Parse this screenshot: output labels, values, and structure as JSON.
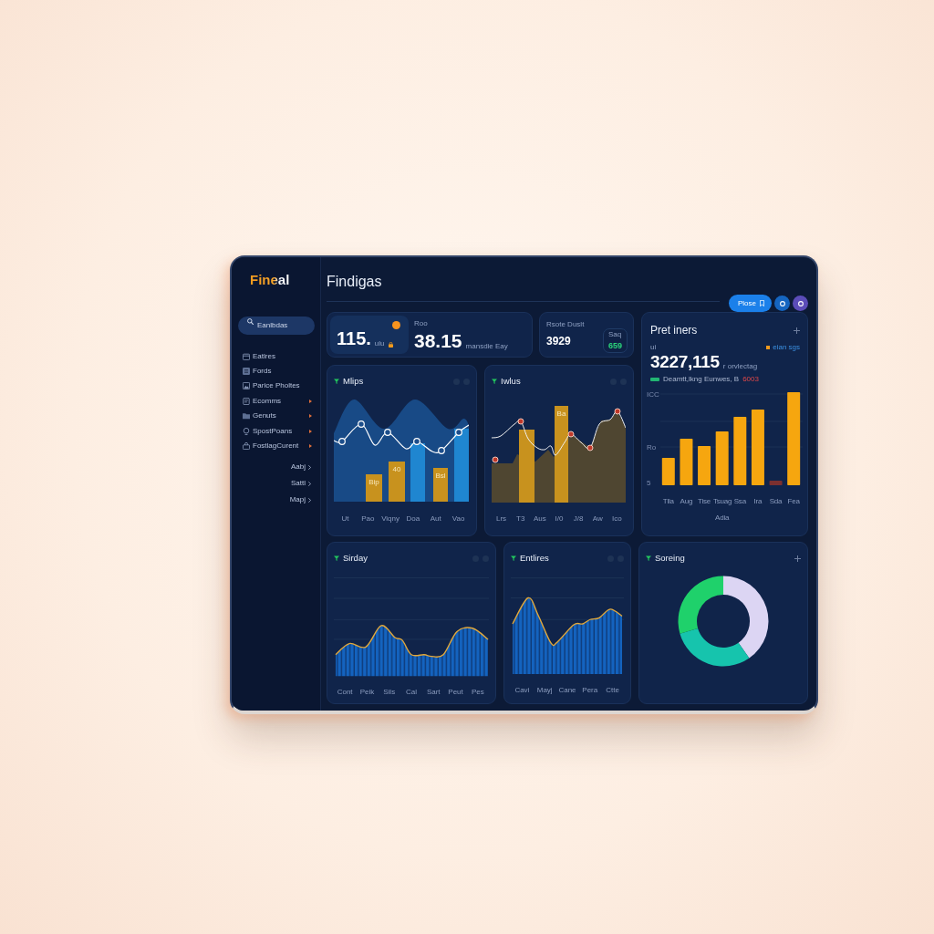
{
  "sidebar": {
    "logo": "Fineal",
    "search": {
      "placeholder": "Eanlbdas"
    },
    "items": [
      {
        "label": "Eatlres",
        "submenu": false
      },
      {
        "label": "Fords",
        "submenu": false
      },
      {
        "label": "Parice Pholtes",
        "submenu": false
      },
      {
        "label": "Ecomms",
        "submenu": true
      },
      {
        "label": "Genuts",
        "submenu": true
      },
      {
        "label": "SpostPoans",
        "submenu": true
      },
      {
        "label": "FostlagCurent",
        "submenu": true
      }
    ],
    "links": [
      "Aabj",
      "Sattl",
      "Mapj"
    ]
  },
  "header": {
    "title": "Findigas",
    "button": "Plose"
  },
  "stats": {
    "primary": {
      "value": "115.",
      "unit": "ulu"
    },
    "secondary": {
      "label": "Roo",
      "value": "38.15",
      "caption": "mansdie Eay"
    }
  },
  "balance": {
    "label": "Rsote Duslt",
    "value": "3929",
    "badge": {
      "label": "Saq",
      "value": "659"
    }
  },
  "revenue": {
    "title": "Pret iners",
    "axis_unit": "ui",
    "total": "3227,115",
    "total_caption": "r orvlectag",
    "tag": "eian sgs",
    "legend": {
      "label": "Deamtt,lkng Eunwes, B",
      "value": "6003"
    },
    "y_labels": [
      "ICC",
      "Ro",
      "5"
    ],
    "x_labels": [
      "Tlla",
      "Aug",
      "Tise",
      "Tsuag Adia",
      "Ssa",
      "Ira",
      "Sda",
      "Fea"
    ]
  },
  "charts": [
    {
      "title": "Mlips",
      "kind": "area_bars",
      "bar_labels": [
        "Bip",
        "40",
        "Bsl"
      ],
      "x_labels": [
        "Ut",
        "Pao",
        "Viqny",
        "Doa",
        "Aut",
        "Vao"
      ]
    },
    {
      "title": "Iwlus",
      "kind": "line_bars",
      "bar_labels": [
        "Ba"
      ],
      "x_labels": [
        "Lrs",
        "T3",
        "Aus",
        "I/0",
        "J/8",
        "Aw",
        "Ico"
      ]
    }
  ],
  "trends": [
    {
      "title": "Sirday",
      "x_labels": [
        "Cont",
        "Peik",
        "Sils",
        "Cal",
        "Sart",
        "Peut",
        "Pes"
      ]
    },
    {
      "title": "Entlires",
      "x_labels": [
        "Cavi",
        "Mayj",
        "Cane",
        "Pera",
        "Ctte"
      ]
    }
  ],
  "donut": {
    "title": "Soreing"
  }
}
